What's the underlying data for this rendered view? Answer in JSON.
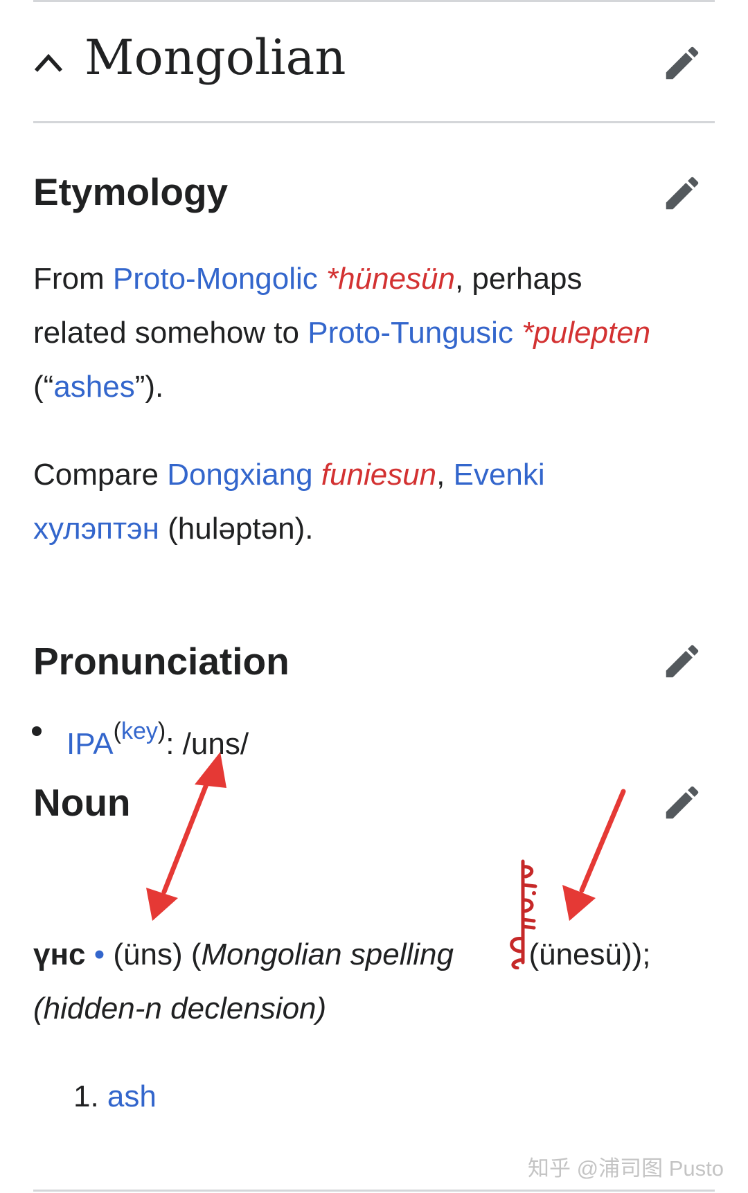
{
  "language": {
    "title": "Mongolian",
    "collapse_icon": "chevron-up-icon",
    "edit_icon": "pencil-icon"
  },
  "etymology": {
    "heading": "Etymology",
    "p1": {
      "t1": "From ",
      "link_proto_mongolic": "Proto-Mongolic",
      "t2": " ",
      "term_hunesun": "*hünesün",
      "t3": ", perhaps",
      "t4": "related somehow to ",
      "link_proto_tungusic": "Proto-Tungusic",
      "t5": " ",
      "term_pulepten": "*pulepten",
      "t6": "(“",
      "link_ashes": "ashes",
      "t7": "”)."
    },
    "p2": {
      "t1": "Compare ",
      "link_dongxiang": "Dongxiang",
      "t2": " ",
      "term_funiesun": "funiesun",
      "t3": ", ",
      "link_evenki": "Evenki",
      "link_hulepten": "хулэптэн",
      "t4": " (huləptən)."
    }
  },
  "pronunciation": {
    "heading": "Pronunciation",
    "ipa_link": "IPA",
    "key_open": "(",
    "key_link": "key",
    "key_close": ")",
    "ipa_value": ": /uns/"
  },
  "noun": {
    "heading": "Noun",
    "headword": "үнс",
    "bullet": "•",
    "translit": " (üns) (",
    "spelling_label": "Mongolian spelling",
    "spelling_script": "ᠦᠨᠡᠰᠦ",
    "spelling_translit": " (ünesü));",
    "declension": "(hidden-n declension)",
    "sense_number": "1. ",
    "sense_link": "ash"
  },
  "watermark": "知乎 @浦司图 Pusto",
  "colors": {
    "link": "#3366cc",
    "term": "#d33232",
    "annotation_arrow": "#e53935",
    "text": "#202122",
    "icon": "#54595d",
    "divider": "#d4d6d9"
  }
}
